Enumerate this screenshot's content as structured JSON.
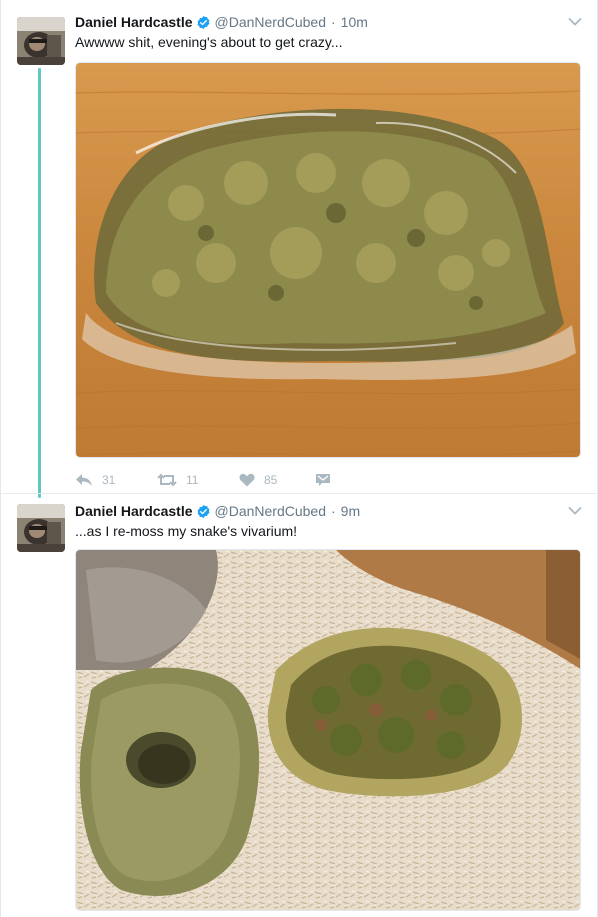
{
  "tweets": [
    {
      "author_name": "Daniel Hardcastle",
      "handle": "@DanNerdCubed",
      "separator": "·",
      "time": "10m",
      "text": "Awwww shit, evening's about to get crazy...",
      "media_icon": "moss-in-bag-photo",
      "actions": {
        "reply_count": "31",
        "retweet_count": "11",
        "like_count": "85"
      }
    },
    {
      "author_name": "Daniel Hardcastle",
      "handle": "@DanNerdCubed",
      "separator": "·",
      "time": "9m",
      "text": "...as I re-moss my snake's vivarium!",
      "media_icon": "vivarium-photo"
    }
  ],
  "colors": {
    "thread_line": "#5ec6c3",
    "verified_badge": "#1da1f2",
    "secondary_text": "#657786",
    "action_icon": "#aab8c2"
  }
}
